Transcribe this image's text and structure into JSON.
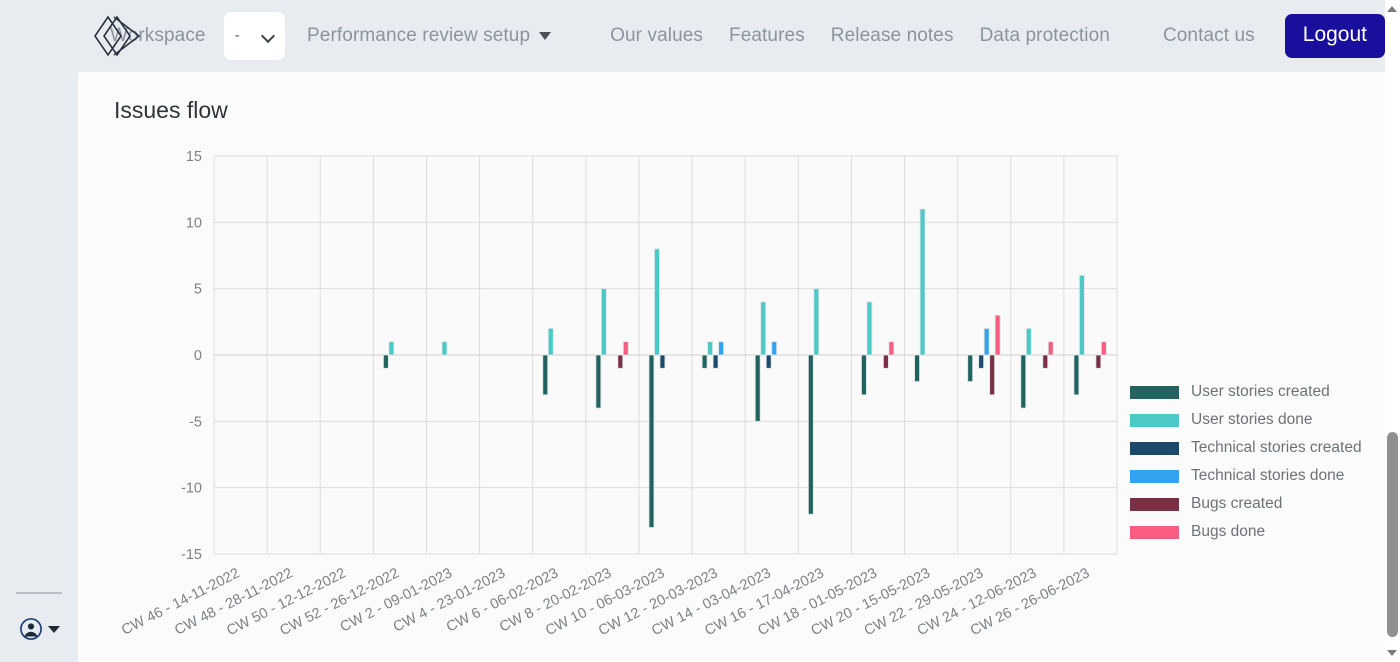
{
  "sidebar": {
    "avatar_icon": "user-avatar-icon",
    "caret_icon": "caret-down-icon"
  },
  "topbar": {
    "logo_icon": "brand-diamond-logo",
    "workspace_label": "Workspace",
    "workspace_select_value": "-",
    "workspace_select_icon": "chevron-down-icon",
    "performance_label": "Performance review setup",
    "performance_caret_icon": "triangle-down-icon",
    "nav_items": [
      {
        "label": "Our values"
      },
      {
        "label": "Features"
      },
      {
        "label": "Release notes"
      },
      {
        "label": "Data protection"
      }
    ],
    "contact_label": "Contact us",
    "logout_label": "Logout",
    "logout_color": "#190f9c"
  },
  "main": {
    "title": "Issues flow"
  },
  "scrollbar": {
    "up_icon": "scroll-up-arrow-icon",
    "down_icon": "scroll-down-arrow-icon"
  },
  "chart_data": {
    "type": "bar",
    "title": "Issues flow",
    "xlabel": "",
    "ylabel": "",
    "ylim": [
      -15,
      15
    ],
    "yticks": [
      15,
      10,
      5,
      0,
      -5,
      -10,
      -15
    ],
    "grid": true,
    "legend_position": "right",
    "stacked": false,
    "categories": [
      "CW 46 - 14-11-2022",
      "CW 48 - 28-11-2022",
      "CW 50 - 12-12-2022",
      "CW 52 - 26-12-2022",
      "CW 2 - 09-01-2023",
      "CW 4 - 23-01-2023",
      "CW 6 - 06-02-2023",
      "CW 8 - 20-02-2023",
      "CW 10 - 06-03-2023",
      "CW 12 - 20-03-2023",
      "CW 14 - 03-04-2023",
      "CW 16 - 17-04-2023",
      "CW 18 - 01-05-2023",
      "CW 20 - 15-05-2023",
      "CW 22 - 29-05-2023",
      "CW 24 - 12-06-2023",
      "CW 26 - 26-06-2023"
    ],
    "series": [
      {
        "name": "User stories created",
        "color": "#21635e",
        "values": [
          0,
          0,
          0,
          -1,
          0,
          0,
          -3,
          -4,
          -13,
          -1,
          -5,
          -12,
          -3,
          -2,
          -2,
          -4,
          -3
        ]
      },
      {
        "name": "User stories done",
        "color": "#4cc9c6",
        "values": [
          0,
          0,
          0,
          1,
          1,
          0,
          2,
          5,
          8,
          1,
          4,
          5,
          4,
          11,
          0,
          2,
          6
        ]
      },
      {
        "name": "Technical stories created",
        "color": "#1b4a6b",
        "values": [
          0,
          0,
          0,
          0,
          0,
          0,
          0,
          0,
          -1,
          -1,
          -1,
          0,
          0,
          0,
          -1,
          0,
          0
        ]
      },
      {
        "name": "Technical stories done",
        "color": "#33a3f0",
        "values": [
          0,
          0,
          0,
          0,
          0,
          0,
          0,
          0,
          0,
          1,
          1,
          0,
          0,
          0,
          2,
          0,
          0
        ]
      },
      {
        "name": "Bugs created",
        "color": "#7c2e44",
        "values": [
          0,
          0,
          0,
          0,
          0,
          0,
          0,
          -1,
          0,
          0,
          0,
          0,
          -1,
          0,
          -3,
          -1,
          -1
        ]
      },
      {
        "name": "Bugs done",
        "color": "#fa5c81",
        "values": [
          0,
          0,
          0,
          0,
          0,
          0,
          0,
          1,
          0,
          0,
          0,
          0,
          1,
          0,
          3,
          1,
          1
        ]
      }
    ]
  }
}
